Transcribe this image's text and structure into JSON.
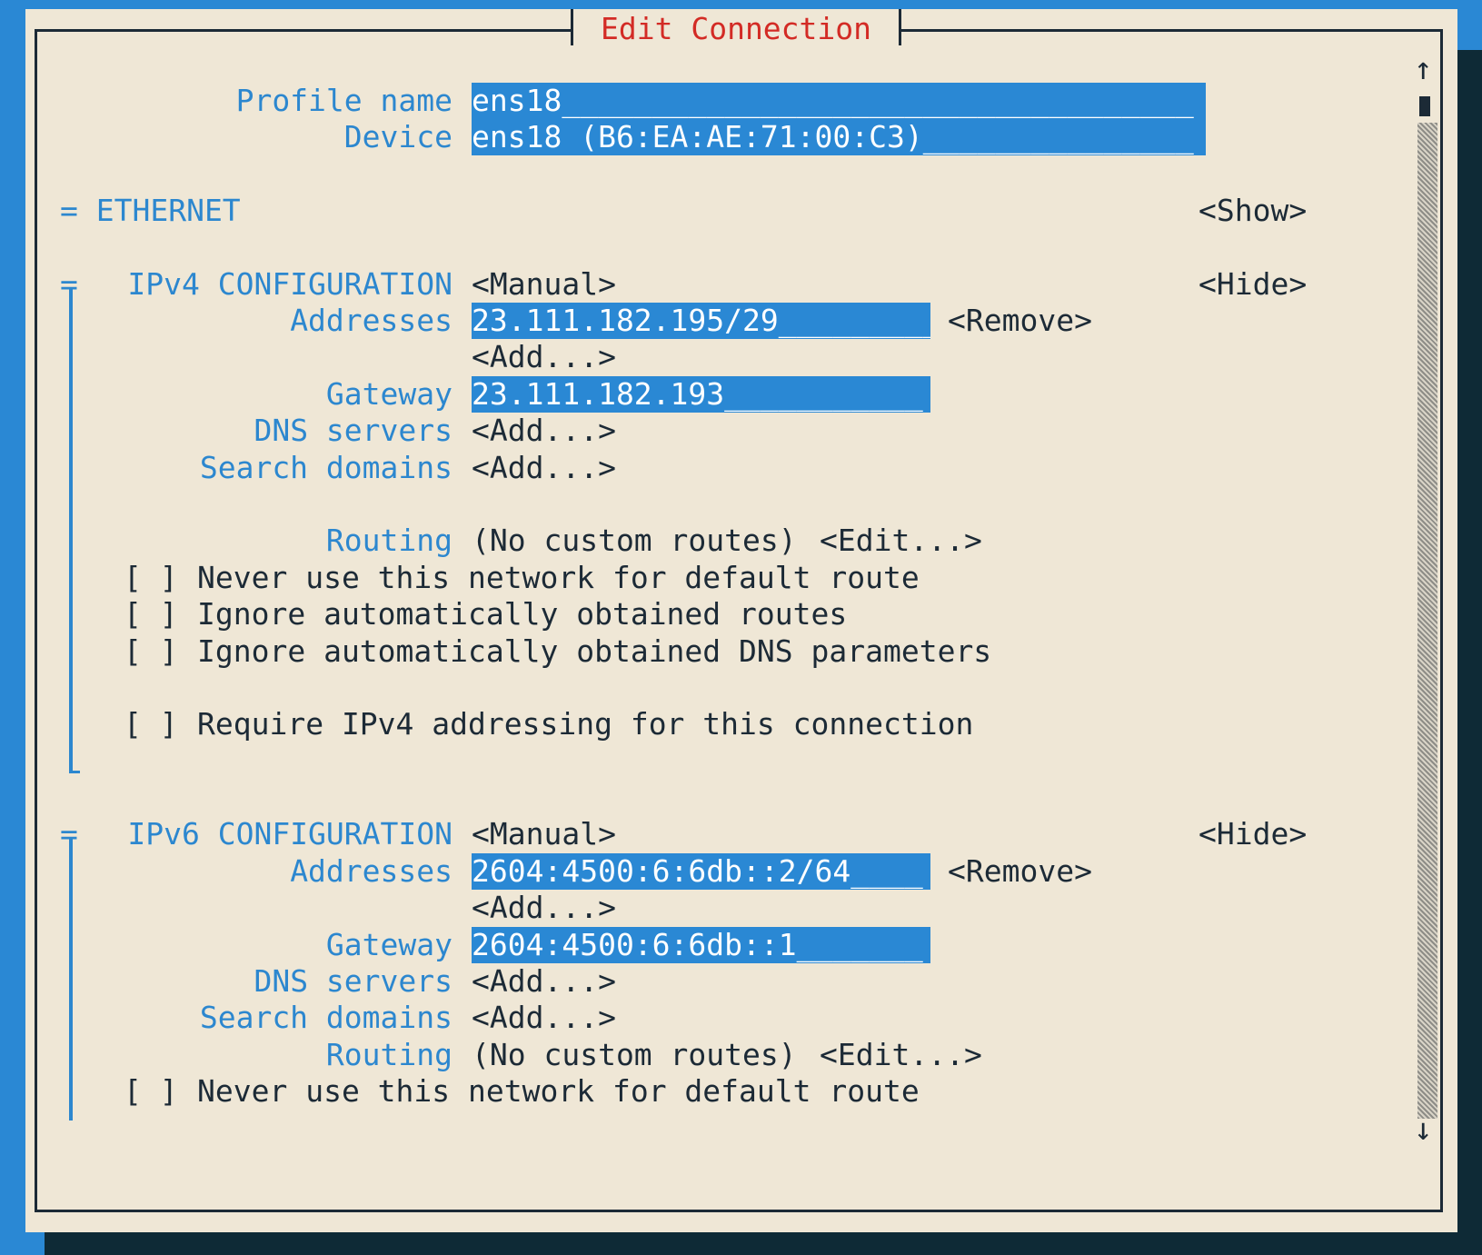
{
  "dialog": {
    "title": "Edit Connection",
    "profile_label": "Profile name",
    "profile_value": "ens18___________________________________",
    "device_label": "Device",
    "device_value": "ens18 (B6:EA:AE:71:00:C3)_______________"
  },
  "ethernet": {
    "header": "= ETHERNET",
    "toggle": "<Show>"
  },
  "ipv4": {
    "marker": "=",
    "header": "IPv4 CONFIGURATION",
    "method": "<Manual>",
    "toggle": "<Hide>",
    "addresses_label": "Addresses",
    "address_value": "23.111.182.195/29_________",
    "remove": "<Remove>",
    "add_address": "<Add...>",
    "gateway_label": "Gateway",
    "gateway_value": "23.111.182.193___________",
    "dns_label": "DNS servers",
    "dns_add": "<Add...>",
    "search_label": "Search domains",
    "search_add": "<Add...>",
    "routing_label": "Routing",
    "routing_value": "(No custom routes)",
    "routing_edit": "<Edit...>",
    "checkbox": "[ ]",
    "opt_never_default": "Never use this network for default route",
    "opt_ignore_routes": "Ignore automatically obtained routes",
    "opt_ignore_dns": "Ignore automatically obtained DNS parameters",
    "opt_require": "Require IPv4 addressing for this connection"
  },
  "ipv6": {
    "marker": "=",
    "header": "IPv6 CONFIGURATION",
    "method": "<Manual>",
    "toggle": "<Hide>",
    "addresses_label": "Addresses",
    "address_value": "2604:4500:6:6db::2/64____",
    "remove": "<Remove>",
    "add_address": "<Add...>",
    "gateway_label": "Gateway",
    "gateway_value": "2604:4500:6:6db::1_______",
    "dns_label": "DNS servers",
    "dns_add": "<Add...>",
    "search_label": "Search domains",
    "search_add": "<Add...>",
    "routing_label": "Routing",
    "routing_value": "(No custom routes)",
    "routing_edit": "<Edit...>",
    "checkbox": "[ ]",
    "opt_never_default": "Never use this network for default route"
  },
  "scrollbar": {
    "up": "↑",
    "down": "↓"
  },
  "colors": {
    "accent": "#2a88d4",
    "label": "#2c87cf",
    "title": "#d32b25",
    "background": "#efe7d6",
    "text": "#1c2a36"
  }
}
